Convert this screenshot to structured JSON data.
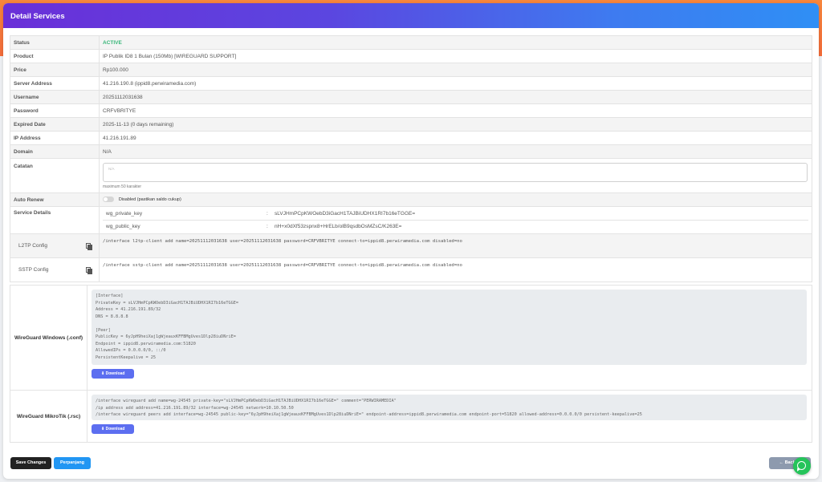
{
  "header": {
    "title": "Detail Services"
  },
  "details": {
    "status": {
      "label": "Status",
      "value": "ACTIVE"
    },
    "product": {
      "label": "Product",
      "value": "IP Publik ID8 1 Bulan (150Mb) [WIREGUARD SUPPORT]"
    },
    "price": {
      "label": "Price",
      "value": "Rp100.000"
    },
    "server_address": {
      "label": "Server Address",
      "value": "41.216.190.8 (ippid8.perwiramedia.com)"
    },
    "username": {
      "label": "Username",
      "value": "20251112031638"
    },
    "password": {
      "label": "Password",
      "value": "CRFVBRITYE"
    },
    "expired_date": {
      "label": "Expired Date",
      "value": "2025-11-13 (0 days remaining)"
    },
    "ip_address": {
      "label": "IP Address",
      "value": "41.216.191.89"
    },
    "domain": {
      "label": "Domain",
      "value": "N/A"
    },
    "catatan": {
      "label": "Catatan",
      "placeholder": "N/A",
      "hint": "maximum 50 karakter"
    },
    "auto_renew": {
      "label": "Auto Renew",
      "value": "Disabled (pastikan saldo cukup)"
    },
    "service_details": {
      "label": "Service Details",
      "items": [
        {
          "key": "wg_private_key",
          "sep": ":",
          "value": "sLVJHmPCpKWOebD3iGacH1TAJBiUDHX1RI7b16eTGGE="
        },
        {
          "key": "wg_public_key",
          "sep": ":",
          "value": "nH+x0dXf53zspnx8+HrELb/olB9qsdbOsMZsC/K263E="
        }
      ]
    },
    "l2tp": {
      "label": "L2TP Config",
      "value": "/interface l2tp-client add name=20251112031638 user=20251112031638 password=CRFVBRITYE connect-to=ippid8.perwiramedia.com disabled=no"
    },
    "sstp": {
      "label": "SSTP Config",
      "value": "/interface sstp-client add name=20251112031638 user=20251112031638 password=CRFVBRITYE connect-to=ippid8.perwiramedia.com disabled=no"
    }
  },
  "wireguard": {
    "windows": {
      "label": "WireGuard Windows (.conf)",
      "config": "[Interface]\nPrivateKey = sLVJHmPCpKWOebD3iGacH1TAJBiUDHX1RI7b16eTGGE=\nAddress = 41.216.191.89/32\nDNS = 8.8.8.8\n\n[Peer]\nPublicKey = 6yJpH9heiXaj1gWjeauxKFFBMgUves1Dlp28iuDNriE=\nEndpoint = ippid8.perwiramedia.com:51820\nAllowedIPs = 0.0.0.0/0, ::/0\nPersistentKeepalive = 25",
      "download_label": "⬇ Download"
    },
    "mikrotik": {
      "label": "WireGuard MikroTik (.rsc)",
      "config": "/interface wireguard add name=wg-24545 private-key=\"sLVJHmPCpKWOebD3iGacH1TAJBiUDHX1RI7b16eTGGE=\" comment=\"PERWIRAMEDIA\"\n/ip address add address=41.216.191.89/32 interface=wg-24545 network=10.10.50.50\n/interface wireguard peers add interface=wg-24545 public-key=\"6yJpH9heiXaj1gWjeauxKFFBMgUves1Dlp28iuDNriE=\" endpoint-address=ippid8.perwiramedia.com endpoint-port=51820 allowed-address=0.0.0.0/0 persistent-keepalive=25",
      "download_label": "⬇ Download"
    }
  },
  "footer": {
    "save_label": "Save Changes",
    "extend_label": "Perpanjang",
    "back_label": "← Back to"
  },
  "colors": {
    "active": "#38b678",
    "save_button": "#222222",
    "extend_button": "#2196f3",
    "back_button": "#8d9aae",
    "whatsapp": "#25c45a"
  },
  "icons": {
    "copy": "copy-icon",
    "download": "download-icon",
    "whatsapp": "whatsapp-icon",
    "back": "arrow-left-icon"
  }
}
